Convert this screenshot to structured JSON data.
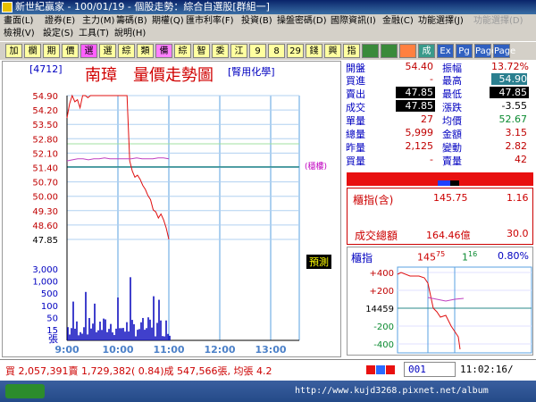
{
  "window": {
    "title": "新世紀贏家 - 100/01/19 - 個股走勢：綜合自選股[群組一]"
  },
  "menu": {
    "row1": [
      "畫面(L)",
      "證券(E)",
      "主力(M)",
      "籌碼(B)",
      "期權(Q)",
      "匯市利率(F)",
      "投資(B)",
      "操盤密碼(D)",
      "國際資訊(I)",
      "金融(C)",
      "功能選擇(J)",
      "功能選擇(D)"
    ],
    "row2": [
      "檢視(V)",
      "設定(S)",
      "工具(T)",
      "說明(H)"
    ]
  },
  "toolbar": {
    "buttons": [
      "加",
      "欄",
      "期",
      "價",
      "選",
      "選",
      "綜",
      "類",
      "備",
      "綜",
      "智",
      "委",
      "江",
      "9",
      "8",
      "29",
      "錢",
      "興",
      "指",
      "",
      "",
      "",
      "成",
      "Ex",
      "Pg",
      "Page",
      "Page"
    ]
  },
  "stock": {
    "code": "[4712]",
    "name": "南璋",
    "chart_title": "量價走勢圖",
    "sector": "[腎用化學]",
    "ref_tag": "(穩樓)",
    "open_auction_tag": "預測"
  },
  "quote": {
    "open_label": "開盤",
    "open": "54.40",
    "amplitude_label": "振幅",
    "amplitude": "13.72%",
    "bid_label": "買進",
    "bid": "-",
    "high_label": "最高",
    "high": "54.90",
    "ask_label": "賣出",
    "ask": "47.85",
    "low_label": "最低",
    "low": "47.85",
    "last_label": "成交",
    "last": "47.85",
    "change_label": "漲跌",
    "change": "-3.55",
    "tick_vol_label": "單量",
    "tick_vol": "27",
    "avg_label": "均價",
    "avg": "52.67",
    "total_vol_label": "總量",
    "total_vol": "5,999",
    "amount_label": "金額",
    "amount": "3.15",
    "prev_vol_label": "昨量",
    "prev_vol": "2,125",
    "turnover_label": "變動",
    "turnover": "2.82",
    "buy_vol_label": "買量",
    "buy_vol": "-",
    "sell_vol_label": "賣量",
    "sell_vol": "42"
  },
  "index_box": {
    "label": "櫃指(含)",
    "value": "145.75",
    "change": "1.16",
    "total_label": "成交總額",
    "total": "164.46億",
    "total_change": "30.0"
  },
  "mini_index": {
    "label": "櫃指",
    "value": "145",
    "value_sup": "75",
    "change": "1",
    "change_sup": "16",
    "pct": "0.80%",
    "yticks": [
      "+400",
      "+200",
      "14459",
      "-200",
      "-400"
    ]
  },
  "statusbar": {
    "text": "買 2,057,391賣 1,729,382( 0.84)成 547,566張, 均張 4.2",
    "code": "001",
    "time": "11:02:16/"
  },
  "taskbar": {
    "watermark": "http://www.kujd3268.pixnet.net/album"
  },
  "chart_data": {
    "type": "line",
    "price_yticks": [
      "54.90",
      "54.20",
      "53.50",
      "52.80",
      "52.10",
      "51.40",
      "50.70",
      "50.00",
      "49.30",
      "48.60",
      "47.85"
    ],
    "vol_yticks": [
      "3,000",
      "1,000",
      "500",
      "100",
      "50",
      "15"
    ],
    "vol_unit": "張",
    "xticks": [
      "9:00",
      "10:00",
      "11:00",
      "12:00",
      "13:00"
    ],
    "ylim": [
      47.85,
      54.9
    ],
    "ref_price": 51.4,
    "series": [
      {
        "values": [
          53.8,
          54.5,
          54.9,
          54.6,
          54.7,
          54.3,
          54.9,
          54.9,
          54.8,
          54.9,
          54.9,
          54.9,
          54.9,
          54.9,
          54.9,
          54.9,
          54.9,
          54.9,
          54.9,
          54.9,
          54.9,
          54.9,
          54.9,
          54.9,
          51.7,
          51.2,
          50.9,
          51.0,
          50.8,
          50.5,
          50.3,
          50.0,
          49.8,
          49.3,
          49.2,
          48.9,
          49.1,
          48.8,
          48.4,
          47.85
        ]
      },
      {
        "values": [
          51.7,
          51.75,
          51.8,
          51.8,
          51.75,
          51.8,
          51.8,
          51.85,
          51.8,
          51.8,
          51.8,
          51.8,
          51.8,
          51.85,
          51.8,
          51.8,
          51.8,
          51.85,
          51.85,
          51.8
        ]
      }
    ]
  }
}
